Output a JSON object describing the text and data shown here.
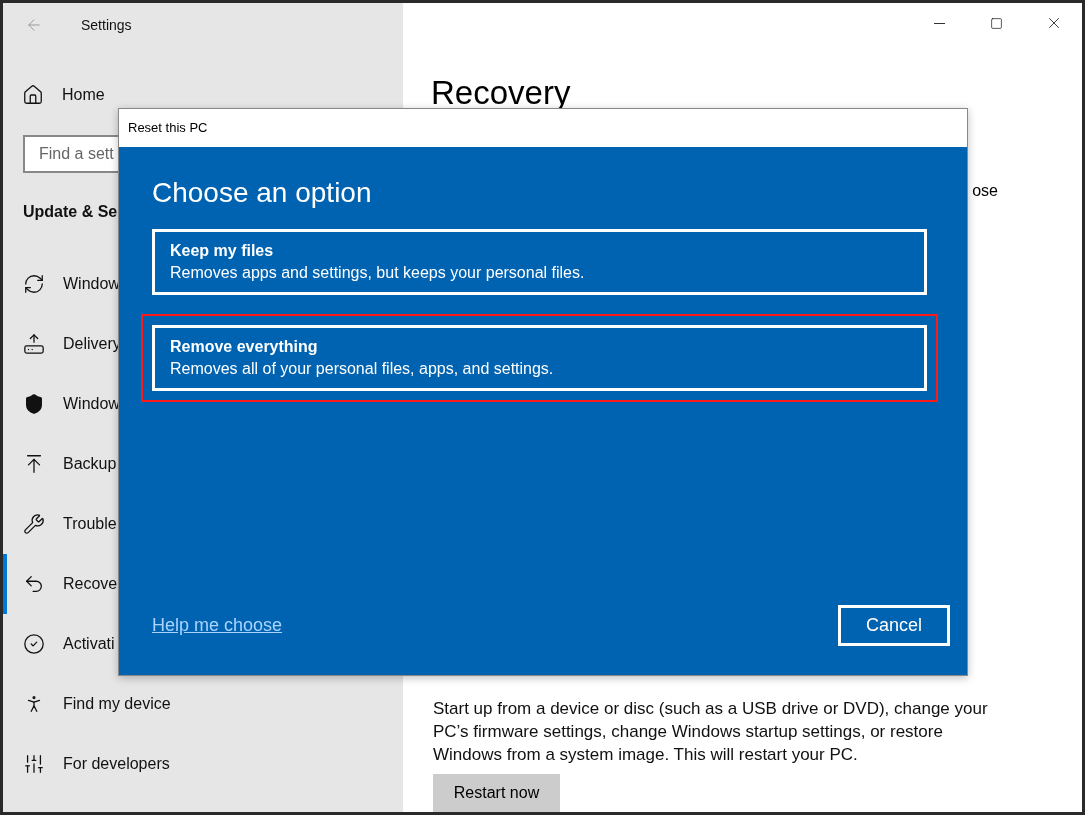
{
  "window": {
    "title": "Settings"
  },
  "sidebar": {
    "home": "Home",
    "search": {
      "placeholder": "Find a sett"
    },
    "heading": "Update & Se",
    "items": [
      {
        "label": "Window",
        "selected": false
      },
      {
        "label": "Delivery",
        "selected": false
      },
      {
        "label": "Window",
        "selected": false
      },
      {
        "label": "Backup",
        "selected": false
      },
      {
        "label": "Trouble",
        "selected": false
      },
      {
        "label": "Recove",
        "selected": true
      },
      {
        "label": "Activati",
        "selected": false
      },
      {
        "label": "Find my device",
        "selected": false
      },
      {
        "label": "For developers",
        "selected": false
      }
    ]
  },
  "page": {
    "title": "Recovery",
    "partial_text": "ose",
    "description": "Start up from a device or disc (such as a USB drive or DVD), change your PC’s firmware settings, change Windows startup settings, or restore Windows from a system image. This will restart your PC.",
    "button": "Restart now"
  },
  "dialog": {
    "title": "Reset this PC",
    "heading": "Choose an option",
    "options": [
      {
        "title": "Keep my files",
        "description": "Removes apps and settings, but keeps your personal files.",
        "highlighted": false
      },
      {
        "title": "Remove everything",
        "description": "Removes all of your personal files, apps, and settings.",
        "highlighted": true
      }
    ],
    "help_link": "Help me choose",
    "cancel": "Cancel"
  }
}
